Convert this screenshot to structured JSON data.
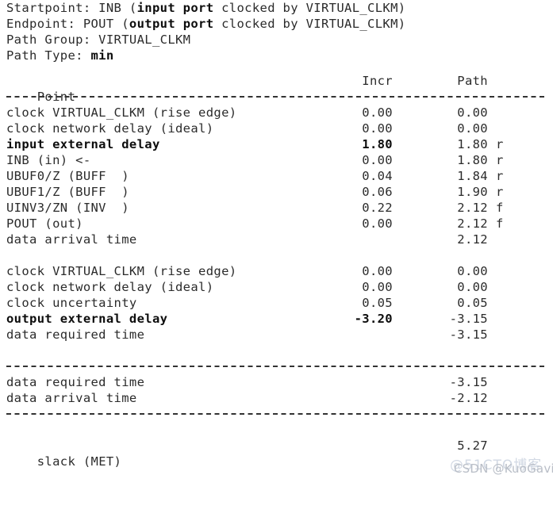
{
  "report": {
    "header_lines": [
      {
        "prefix": "Startpoint: INB (",
        "bold": "input port",
        "suffix": " clocked by VIRTUAL_CLKM)"
      },
      {
        "prefix": "Endpoint: POUT (",
        "bold": "output port",
        "suffix": " clocked by VIRTUAL_CLKM)"
      },
      {
        "prefix": "Path Group: VIRTUAL_CLKM",
        "bold": "",
        "suffix": ""
      },
      {
        "prefix": "Path Type: ",
        "bold": "min",
        "suffix": ""
      }
    ],
    "columns": {
      "point": "Point",
      "incr": "Incr",
      "path": "Path"
    },
    "rows": [
      {
        "point": "clock VIRTUAL_CLKM (rise edge)",
        "incr": "0.00",
        "path": "0.00",
        "flag": "",
        "bold": false
      },
      {
        "point": "clock network delay (ideal)",
        "incr": "0.00",
        "path": "0.00",
        "flag": "",
        "bold": false
      },
      {
        "point": "input external delay",
        "incr": "1.80",
        "path": "1.80",
        "flag": "r",
        "bold": true
      },
      {
        "point": "INB (in) <-",
        "incr": "0.00",
        "path": "1.80",
        "flag": "r",
        "bold": false
      },
      {
        "point": "UBUF0/Z (BUFF  )",
        "incr": "0.04",
        "path": "1.84",
        "flag": "r",
        "bold": false
      },
      {
        "point": "UBUF1/Z (BUFF  )",
        "incr": "0.06",
        "path": "1.90",
        "flag": "r",
        "bold": false
      },
      {
        "point": "UINV3/ZN (INV  )",
        "incr": "0.22",
        "path": "2.12",
        "flag": "f",
        "bold": false
      },
      {
        "point": "POUT (out)",
        "incr": "0.00",
        "path": "2.12",
        "flag": "f",
        "bold": false
      },
      {
        "point": "data arrival time",
        "incr": "",
        "path": "2.12",
        "flag": "",
        "bold": false
      }
    ],
    "rows2": [
      {
        "point": "clock VIRTUAL_CLKM (rise edge)",
        "incr": "0.00",
        "path": "0.00",
        "flag": "",
        "bold": false
      },
      {
        "point": "clock network delay (ideal)",
        "incr": "0.00",
        "path": "0.00",
        "flag": "",
        "bold": false
      },
      {
        "point": "clock uncertainty",
        "incr": "0.05",
        "path": "0.05",
        "flag": "",
        "bold": false
      },
      {
        "point": "output external delay",
        "incr": "-3.20",
        "path": "-3.15",
        "flag": "",
        "bold": true
      },
      {
        "point": "data required time",
        "incr": "",
        "path": "-3.15",
        "flag": "",
        "bold": false
      }
    ],
    "summary": [
      {
        "point": "data required time",
        "incr": "",
        "path": "-3.15",
        "flag": "",
        "bold": false
      },
      {
        "point": "data arrival time",
        "incr": "",
        "path": "-2.12",
        "flag": "",
        "bold": false
      }
    ],
    "slack": {
      "point": "slack (MET)",
      "incr": "",
      "path": "5.27",
      "flag": "",
      "bold": false
    }
  },
  "watermarks": {
    "back": "@51CTO博客",
    "front": "CSDN @KuoGavin"
  }
}
